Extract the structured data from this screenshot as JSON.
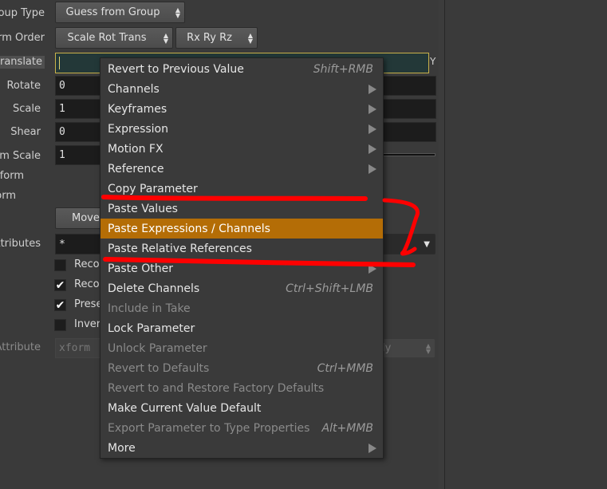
{
  "labels": {
    "group_type": "oup Type",
    "xform_order": "rm Order",
    "translate": "ranslate",
    "rotate": "Rotate",
    "scale": "Scale",
    "shear": "Shear",
    "uniform_scale": "rm Scale",
    "pivot_xform": "form",
    "pre_xform": "orm",
    "attributes": "ttributes",
    "attribute": "Attribute"
  },
  "controls": {
    "group_type_value": "Guess from Group",
    "xform_order_value": "Scale Rot Trans",
    "rotate_order_value": "Rx Ry Rz",
    "rotate_value": "0",
    "scale_value": "1",
    "shear_value": "0",
    "uniform_scale_value": "1",
    "move_button": "Move",
    "attributes_value": "*",
    "y_label": "Y",
    "attribute_value": "xform",
    "attribute_right_value": "ly"
  },
  "checkboxes": [
    {
      "label": "Recor",
      "checked": false
    },
    {
      "label": "Recor",
      "checked": true
    },
    {
      "label": "Prese",
      "checked": true
    },
    {
      "label": "Inver",
      "checked": false
    }
  ],
  "check_glyph": "✔",
  "menu": {
    "items": [
      {
        "label": "Revert to Previous Value",
        "shortcut": "Shift+RMB",
        "submenu": false,
        "disabled": false
      },
      {
        "label": "Channels",
        "shortcut": "",
        "submenu": true,
        "disabled": false
      },
      {
        "label": "Keyframes",
        "shortcut": "",
        "submenu": true,
        "disabled": false
      },
      {
        "label": "Expression",
        "shortcut": "",
        "submenu": true,
        "disabled": false
      },
      {
        "label": "Motion FX",
        "shortcut": "",
        "submenu": true,
        "disabled": false
      },
      {
        "label": "Reference",
        "shortcut": "",
        "submenu": true,
        "disabled": false
      },
      {
        "label": "Copy Parameter",
        "shortcut": "",
        "submenu": false,
        "disabled": false
      },
      {
        "label": "Paste Values",
        "shortcut": "",
        "submenu": false,
        "disabled": false
      },
      {
        "label": "Paste Expressions / Channels",
        "shortcut": "",
        "submenu": false,
        "disabled": false,
        "highlighted": true
      },
      {
        "label": "Paste Relative References",
        "shortcut": "",
        "submenu": false,
        "disabled": false
      },
      {
        "label": "Paste Other",
        "shortcut": "",
        "submenu": true,
        "disabled": false
      },
      {
        "label": "Delete Channels",
        "shortcut": "Ctrl+Shift+LMB",
        "submenu": false,
        "disabled": false
      },
      {
        "label": "Include in Take",
        "shortcut": "",
        "submenu": false,
        "disabled": true
      },
      {
        "label": "Lock Parameter",
        "shortcut": "",
        "submenu": false,
        "disabled": false
      },
      {
        "label": "Unlock Parameter",
        "shortcut": "",
        "submenu": false,
        "disabled": true
      },
      {
        "label": "Revert to Defaults",
        "shortcut": "Ctrl+MMB",
        "submenu": false,
        "disabled": true
      },
      {
        "label": "Revert to and Restore Factory Defaults",
        "shortcut": "",
        "submenu": false,
        "disabled": true
      },
      {
        "label": "Make Current Value Default",
        "shortcut": "",
        "submenu": false,
        "disabled": false
      },
      {
        "label": "Export Parameter to Type Properties",
        "shortcut": "Alt+MMB",
        "submenu": false,
        "disabled": true
      },
      {
        "label": "More",
        "shortcut": "",
        "submenu": true,
        "disabled": false
      }
    ]
  },
  "colors": {
    "highlight": "#b46d06",
    "annotation": "#ff0000",
    "translate_field_border": "#c9b24a"
  }
}
